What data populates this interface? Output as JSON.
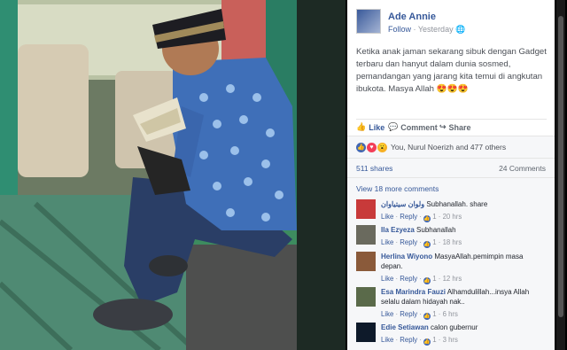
{
  "post": {
    "author": "Ade Annie",
    "follow": "Follow",
    "time": "Yesterday",
    "text": "Ketika anak jaman sekarang sibuk dengan Gadget terbaru dan hanyut dalam dunia sosmed, pemandangan yang jarang kita temui di angkutan ibukota. Masya Allah 😍😍😍"
  },
  "actions": {
    "like": "Like",
    "comment": "Comment",
    "share": "Share"
  },
  "reactions": {
    "summary": "You, Nurul Noerizh and 477 others"
  },
  "stats": {
    "shares": "511 shares",
    "comments": "24 Comments"
  },
  "view_more": "View 18 more comments",
  "comment_actions": {
    "like": "Like",
    "reply": "Reply"
  },
  "comments": [
    {
      "name": "ولوان سيتياوان",
      "text": "Subhanallah. share",
      "likes": "1",
      "time": "20 hrs"
    },
    {
      "name": "Ila Ezyeza",
      "text": "Subhanallah",
      "likes": "1",
      "time": "18 hrs"
    },
    {
      "name": "Herlina Wiyono",
      "text": "MasyaAllah.pemimpin masa depan.",
      "likes": "1",
      "time": "12 hrs"
    },
    {
      "name": "Esa Marindra Fauzi",
      "text": "Alhamdulillah...insya Allah selalu dalam hidayah nak..",
      "likes": "1",
      "time": "6 hrs"
    },
    {
      "name": "Edie Setiawan",
      "text": "calon gubernur",
      "likes": "1",
      "time": "3 hrs"
    }
  ],
  "colors": {
    "link": "#365899",
    "accent": "#4267b2",
    "muted": "#90949c"
  }
}
